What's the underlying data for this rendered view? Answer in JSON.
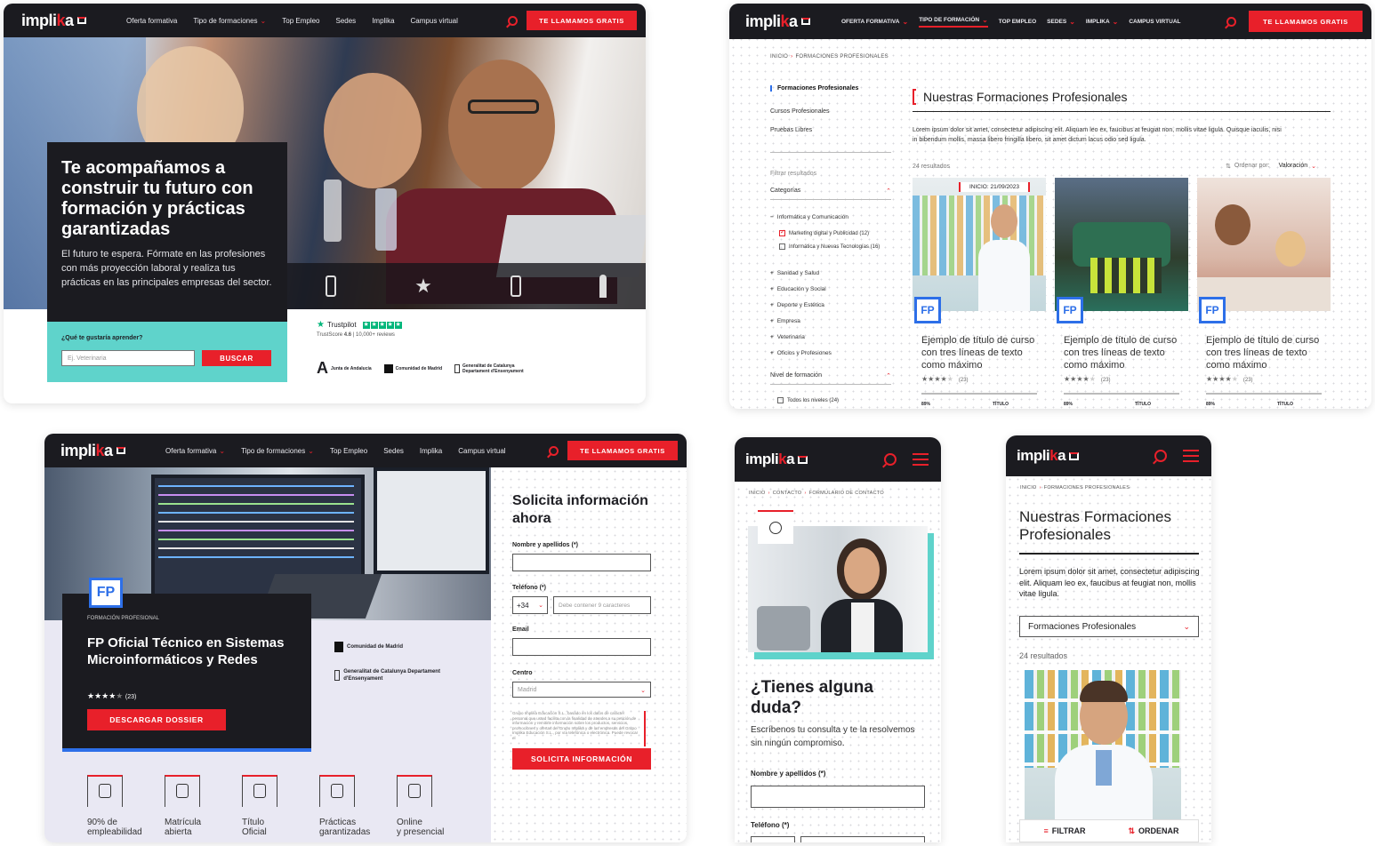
{
  "brand": {
    "logo_main": "impli",
    "logo_k": "k",
    "logo_end": "a",
    "red": "#e8202a",
    "dark": "#1b1b20",
    "teal": "#5fd3cb",
    "fp_blue": "#2d6fe8"
  },
  "panel1": {
    "nav": {
      "items": [
        "Oferta formativa",
        "Tipo de formaciones",
        "Top Empleo",
        "Sedes",
        "Implika",
        "Campus virtual"
      ],
      "cta": "TE LLAMAMOS GRATIS"
    },
    "hero_title": "Te acompañamos a construir tu futuro con formación y prácticas garantizadas",
    "hero_text": "El futuro te espera. Fórmate en las profesiones con más proyección laboral y realiza tus prácticas en las principales empresas del sector.",
    "search_label": "¿Qué te gustaría aprender?",
    "search_placeholder": "Ej. Veterinaria",
    "search_button": "BUSCAR",
    "trustpilot": "Trustpilot",
    "trustscore_label": "TrustScore",
    "trustscore": "4.6",
    "reviews": "10,000+ reviews",
    "logos": [
      "Junta de Andalucía",
      "Comunidad de Madrid",
      "Generalitat de Catalunya Departament d'Ensenyament"
    ]
  },
  "panel2": {
    "nav": {
      "items": [
        "OFERTA FORMATIVA",
        "TIPO DE FORMACIÓN",
        "TOP EMPLEO",
        "SEDES",
        "IMPLIKA",
        "CAMPUS VIRTUAL"
      ],
      "cta": "TE LLAMAMOS GRATIS"
    },
    "breadcrumb": [
      "INICIO",
      "FORMACIONES PROFESIONALES"
    ],
    "side_tabs": [
      "Formaciones Profesionales",
      "Cursos Profesionales",
      "Pruebas Libres"
    ],
    "filter_title": "Filtrar resultados",
    "categories_label": "Categorías",
    "categories": [
      {
        "label": "Informática y Comunicación",
        "sign": "−"
      },
      {
        "label": "Sanidad y Salud",
        "sign": "+"
      },
      {
        "label": "Educación y Social",
        "sign": "+"
      },
      {
        "label": "Deporte y Estética",
        "sign": "+"
      },
      {
        "label": "Empresa",
        "sign": "+"
      },
      {
        "label": "Veterinaria",
        "sign": "+"
      },
      {
        "label": "Oficios y Profesiones",
        "sign": "+"
      }
    ],
    "subcats": [
      {
        "label": "Marketing digital y Publicidad (12)",
        "checked": true
      },
      {
        "label": "Informática y Nuevas Tecnologías (16)",
        "checked": false
      }
    ],
    "level_label": "Nivel de formación",
    "level_all": "Todos los niveles (24)",
    "title": "Nuestras Formaciones Profesionales",
    "intro": "Lorem ipsum dolor sit amet, consectetur adipiscing elit. Aliquam leo ex, faucibus at feugiat non, mollis vitae ligula. Quisque iaculis, nisi in bibendum mollis, massa libero fringilla libero, sit amet dictum lacus odio sed ligula.",
    "results": "24 resultados",
    "order_label": "Ordenar por:",
    "order_value": "Valoración",
    "start_tag": "INICIO: 21/09/2023",
    "cards": [
      {
        "title": "Ejemplo de título de curso con tres líneas de texto como máximo",
        "reviews": "(23)",
        "badge": "FP",
        "meta_left": "89%",
        "meta_right": "TÍTULO"
      },
      {
        "title": "Ejemplo de título de curso con tres líneas de texto como máximo",
        "reviews": "(23)",
        "badge": "FP",
        "meta_left": "89%",
        "meta_right": "TÍTULO"
      },
      {
        "title": "Ejemplo de título de curso con tres líneas de texto como máximo",
        "reviews": "(23)",
        "badge": "FP",
        "meta_left": "89%",
        "meta_right": "TÍTULO"
      }
    ]
  },
  "panel3": {
    "nav": {
      "items": [
        "Oferta formativa",
        "Tipo de formaciones",
        "Top Empleo",
        "Sedes",
        "Implika",
        "Campus virtual"
      ],
      "cta": "TE LLAMAMOS GRATIS"
    },
    "badge": "FP",
    "kicker": "FORMACIÓN PROFESIONAL",
    "title": "FP Oficial Técnico en Sistemas Microinformáticos y Redes",
    "reviews": "(23)",
    "dossier": "DESCARGAR DOSSIER",
    "logos": [
      "Comunidad de Madrid",
      "Generalitat de Catalunya Departament d'Ensenyament"
    ],
    "features": [
      {
        "line1": "90% de",
        "line2": "empleabilidad",
        "icon": "worker-icon"
      },
      {
        "line1": "Matrícula",
        "line2": "abierta",
        "icon": "calendar-icon"
      },
      {
        "line1": "Título",
        "line2": "Oficial",
        "icon": "diploma-icon"
      },
      {
        "line1": "Prácticas",
        "line2": "garantizadas",
        "icon": "id-card-icon"
      },
      {
        "line1": "Online",
        "line2": "y presencial",
        "icon": "laptop-person-icon"
      }
    ],
    "form": {
      "title": "Solicita información ahora",
      "name_label": "Nombre y apellidos (*)",
      "phone_label": "Teléfono (*)",
      "prefix": "+34",
      "phone_placeholder": "Debe contener 9 caracteres",
      "email_label": "Email",
      "center_label": "Centro",
      "center_value": "Madrid",
      "legal": "Grupo Implika Educación S.L., basado en los datos de carácter personal que usted facilita con la finalidad de atender a su petición de información y remitirle información sobre los productos, servicios, promociones y ofertas del Grupo Implika y de las empresas del Grupo Implika Educación S.L., por vía telefónica o electrónica. Puede revocar el",
      "submit": "SOLICITA INFORMACIÓN"
    }
  },
  "panel4": {
    "breadcrumb": [
      "INICIO",
      "CONTACTO",
      "FORMULARIO DE CONTACTO"
    ],
    "title": "¿Tienes alguna duda?",
    "text": "Escríbenos tu consulta y te la resolvemos sin ningún compromiso.",
    "name_label": "Nombre y apellidos (*)",
    "phone_label": "Teléfono (*)"
  },
  "panel5": {
    "breadcrumb": [
      "INICIO",
      "FORMACIONES PROFESIONALES"
    ],
    "title": "Nuestras Formaciones Profesionales",
    "intro": "Lorem ipsum dolor sit amet, consectetur adipiscing elit. Aliquam leo ex, faucibus at feugiat non, mollis vitae ligula.",
    "select_value": "Formaciones Profesionales",
    "results": "24 resultados",
    "filter": "FILTRAR",
    "order": "ORDENAR"
  }
}
